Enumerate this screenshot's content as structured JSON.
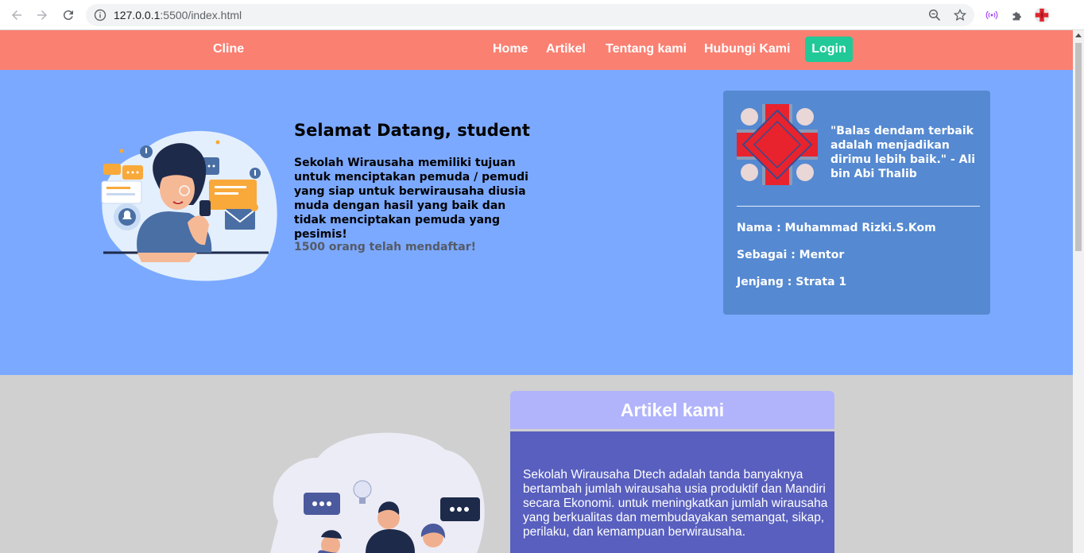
{
  "browser": {
    "url_host": "127.0.0.1",
    "url_rest": ":5500/index.html"
  },
  "navbar": {
    "brand": "Cline",
    "items": [
      "Home",
      "Artikel",
      "Tentang kami",
      "Hubungi Kami"
    ],
    "login": "Login",
    "color": "#fa8072",
    "login_color": "#20c997"
  },
  "hero": {
    "title": "Selamat Datang, student",
    "description": "Sekolah Wirausaha memiliki tujuan untuk menciptakan pemuda / pemudi yang siap untuk berwirausaha diusia muda dengan hasil yang baik dan tidak menciptakan pemuda yang pesimis!",
    "registered": "1500 orang telah mendaftar!",
    "background": "#7ba9ff"
  },
  "mentor_card": {
    "quote": "\"Balas dendam terbaik adalah menjadikan dirimu lebih baik.\" - Ali bin Abi Thalib",
    "name": "Nama : Muhammad Rizki.S.Kom",
    "role": "Sebagai : Mentor",
    "level": "Jenjang : Strata 1"
  },
  "article": {
    "heading": "Artikel kami",
    "body": "Sekolah Wirausaha Dtech adalah tanda banyaknya bertambah jumlah wirausaha usia produktif dan Mandiri secara Ekonomi. untuk meningkatkan jumlah wirausaha yang berkualitas dan membudayakan semangat, sikap, perilaku, dan kemampuan berwirausaha."
  }
}
